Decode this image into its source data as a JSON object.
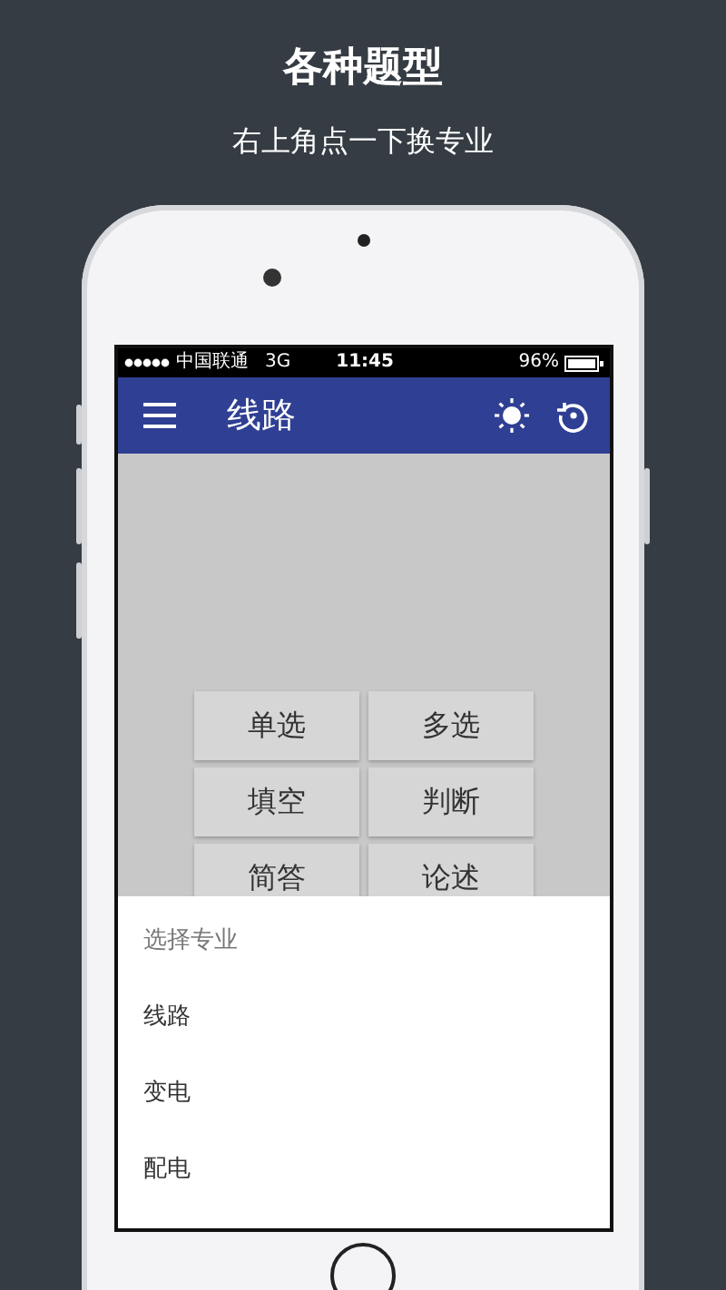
{
  "banner": {
    "title": "各种题型",
    "subtitle": "右上角点一下换专业"
  },
  "status_bar": {
    "carrier": "中国联通",
    "network": "3G",
    "time": "11:45",
    "battery": "96%"
  },
  "app_bar": {
    "title": "线路"
  },
  "question_types": [
    "单选",
    "多选",
    "填空",
    "判断",
    "简答",
    "论述"
  ],
  "sheet": {
    "title": "选择专业",
    "options": [
      "线路",
      "变电",
      "配电"
    ]
  }
}
